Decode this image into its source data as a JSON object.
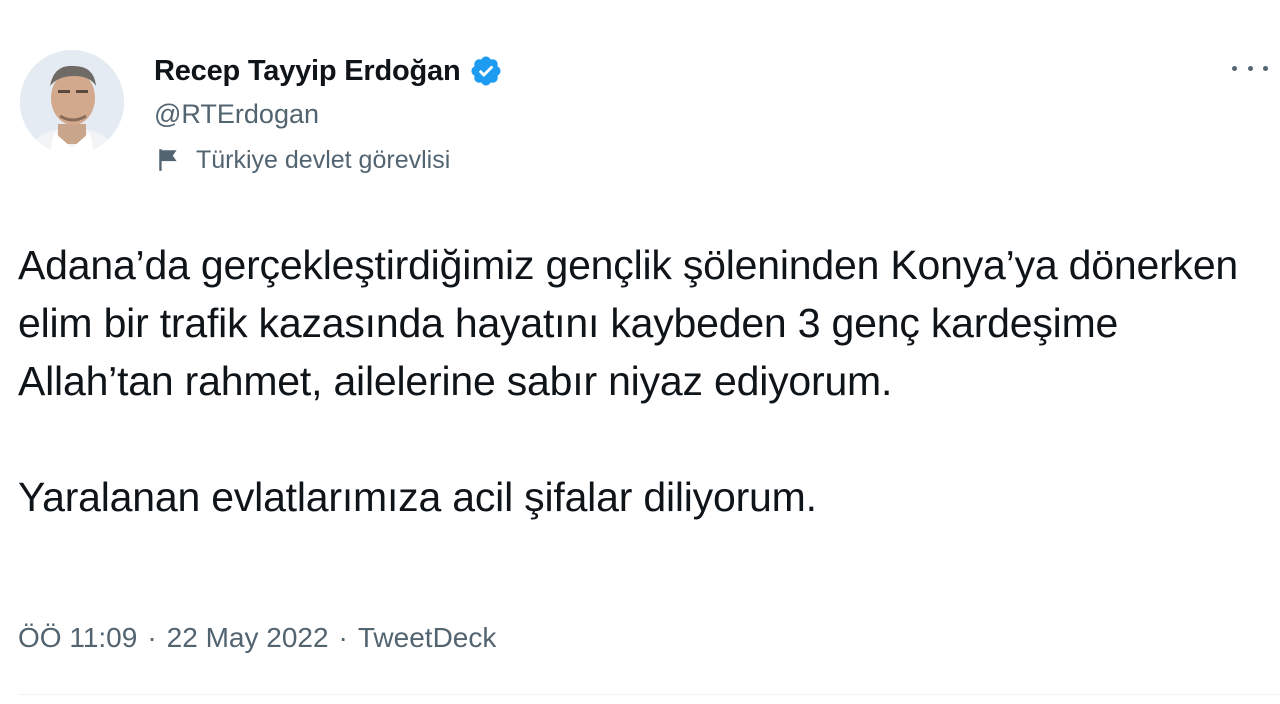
{
  "author": {
    "display_name": "Recep Tayyip Erdoğan",
    "handle": "@RTErdogan",
    "label": "Türkiye devlet görevlisi",
    "verified_color": "#1d9bf0"
  },
  "tweet": {
    "paragraphs": [
      "Adana’da gerçekleştirdiğimiz gençlik şöleninden Konya’ya dönerken elim bir trafik kazasında hayatını kaybeden 3 genç kardeşime Allah’tan rahmet, ailelerine sabır niyaz ediyorum.",
      "Yaralanan evlatlarımıza acil şifalar diliyorum."
    ],
    "time": "ÖÖ 11:09",
    "date": "22 May 2022",
    "separator": "·",
    "source": "TweetDeck"
  },
  "icons": {
    "verified": "verified-badge-icon",
    "flag": "flag-icon",
    "more": "more-options-icon"
  }
}
